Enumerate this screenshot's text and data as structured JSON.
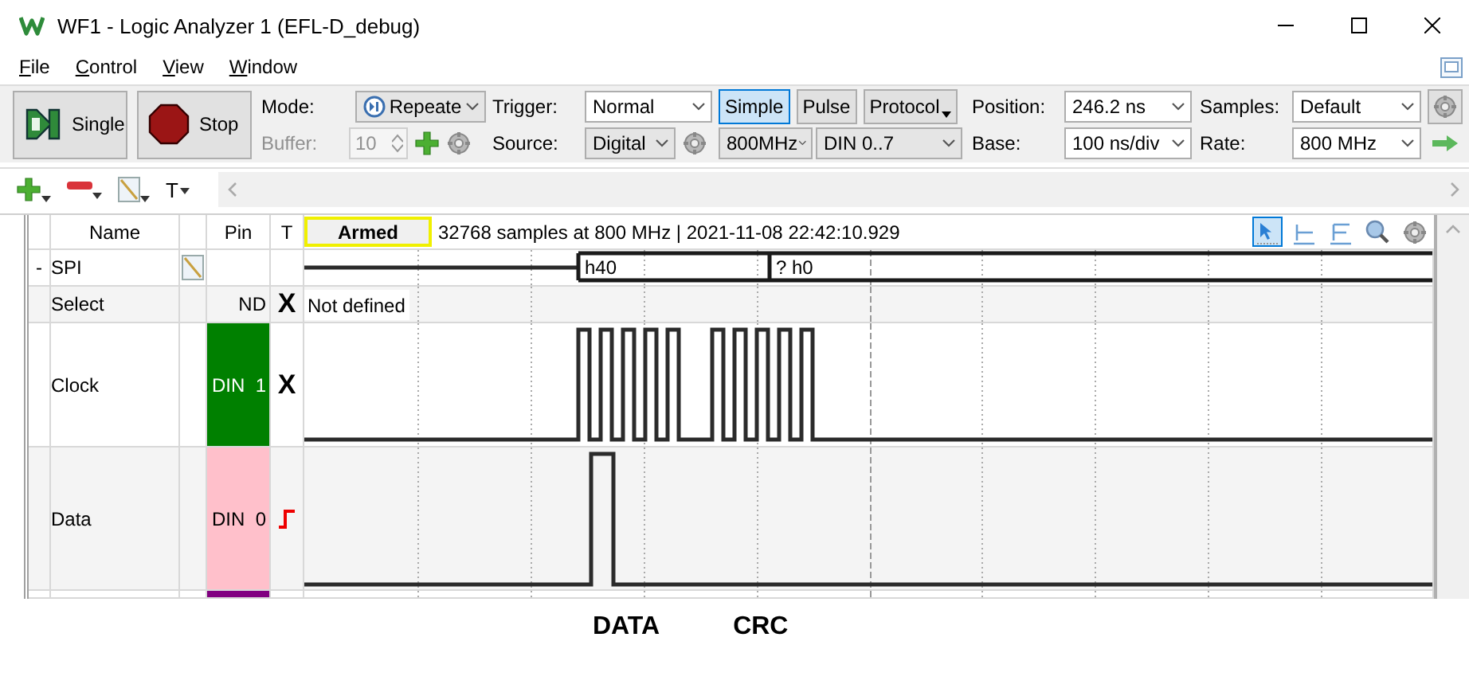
{
  "window": {
    "title": "WF1 - Logic Analyzer 1 (EFL-D_debug)"
  },
  "menu": [
    {
      "label": "File"
    },
    {
      "label": "Control"
    },
    {
      "label": "View"
    },
    {
      "label": "Window"
    }
  ],
  "toolbar": {
    "single": "Single",
    "stop": "Stop",
    "mode_label": "Mode:",
    "mode": "Repeate",
    "buffer_label": "Buffer:",
    "buffer": "10",
    "buffer_disabled": true,
    "trigger_label": "Trigger:",
    "trigger": "Normal",
    "source_label": "Source:",
    "source": "Digital",
    "trigger_types": [
      {
        "label": "Simple",
        "selected": true
      },
      {
        "label": "Pulse",
        "selected": false
      },
      {
        "label": "Protocol",
        "selected": false
      }
    ],
    "source_rate": "800MHz",
    "channels": "DIN 0..7",
    "position_label": "Position:",
    "position": "246.2 ns",
    "base_label": "Base:",
    "base": "100 ns/div",
    "samples_label": "Samples:",
    "samples": "Default",
    "rate_label": "Rate:",
    "rate": "800 MHz"
  },
  "signal_toolbar": {
    "text_tool": "T"
  },
  "table": {
    "columns": [
      "Name",
      "Pin",
      "T"
    ],
    "status": "Armed",
    "info": "32768 samples at 800 MHz | 2021-11-08 22:42:10.929",
    "rows": [
      {
        "kind": "bus",
        "toggle": "-",
        "name": "SPI",
        "segments": [
          "h40",
          "? h0"
        ]
      },
      {
        "kind": "idle",
        "name": "Select",
        "pin": "ND",
        "trigger": "X",
        "value": "Not defined"
      },
      {
        "kind": "clock",
        "name": "Clock",
        "pin": "DIN  1",
        "color": "#008000",
        "trigger": "X"
      },
      {
        "kind": "data",
        "name": "Data",
        "pin": "DIN  0",
        "color": "#ffc0cb",
        "rising_edge_trigger": true
      },
      {
        "kind": "partial",
        "color": "#800080"
      }
    ]
  },
  "annotations": [
    "DATA",
    "CRC"
  ]
}
